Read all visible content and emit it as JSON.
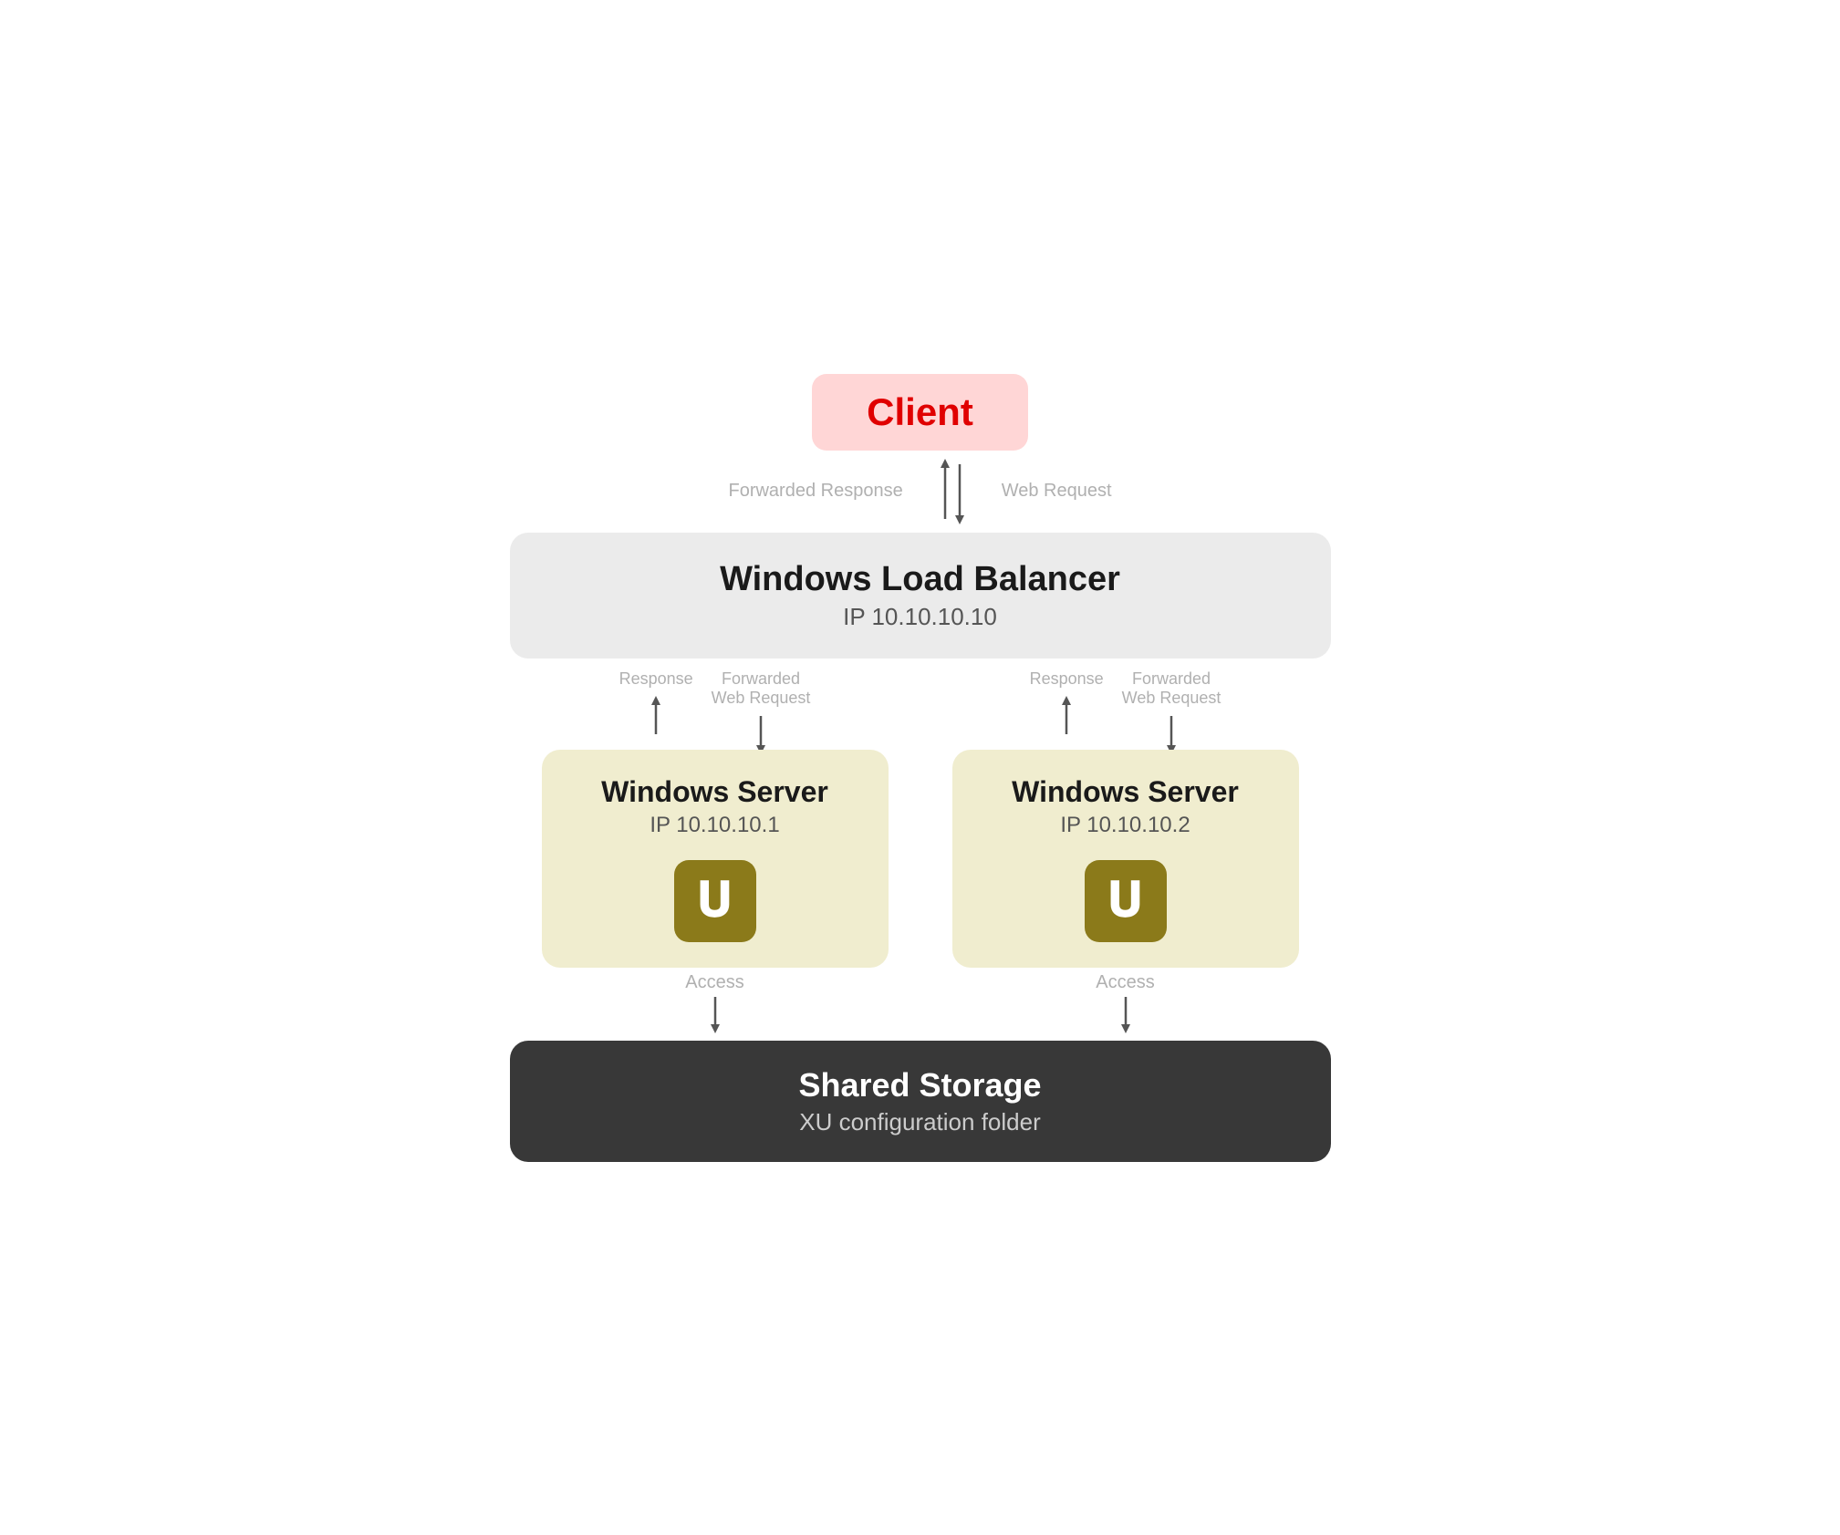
{
  "client": {
    "label": "Client",
    "bg_color": "#ffd6d6",
    "text_color": "#e00000"
  },
  "client_to_lb": {
    "left_label": "Forwarded Response",
    "right_label": "Web Request"
  },
  "load_balancer": {
    "title": "Windows Load Balancer",
    "ip": "IP 10.10.10.10",
    "bg_color": "#ebebeb"
  },
  "server1": {
    "title": "Windows Server",
    "ip": "IP 10.10.10.1",
    "bg_color": "#f0edcf",
    "icon_label": "u",
    "left_arrow_label": "Response",
    "right_arrow_label": "Forwarded\nWeb Request"
  },
  "server2": {
    "title": "Windows Server",
    "ip": "IP 10.10.10.2",
    "bg_color": "#f0edcf",
    "icon_label": "u",
    "left_arrow_label": "Response",
    "right_arrow_label": "Forwarded\nWeb Request"
  },
  "access_label": "Access",
  "shared_storage": {
    "title": "Shared Storage",
    "subtitle": "XU configuration folder",
    "bg_color": "#383838"
  }
}
